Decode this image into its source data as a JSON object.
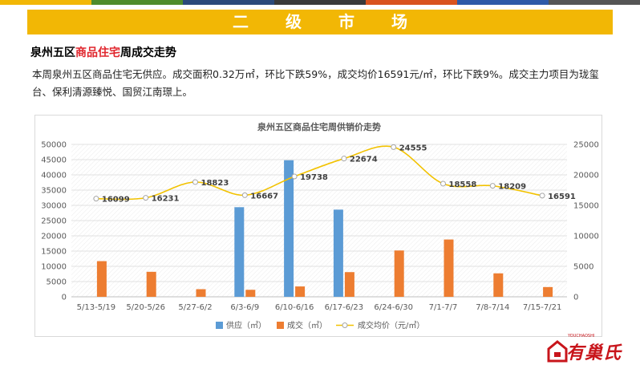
{
  "banner": {
    "title": "二级市场"
  },
  "section": {
    "title_prefix": "泉州五区",
    "title_highlight": "商品住宅",
    "title_suffix": "周成交走势"
  },
  "paragraph": "本周泉州五区商品住宅无供应。成交面积0.32万㎡，环比下跌59%，成交均价16591元/㎡，环比下跌9%。成交主力项目为珑玺台、保利清源臻悦、国贸江南璟上。",
  "colors": {
    "stripes": [
      "#f2b705",
      "#4f8c2b",
      "#2c4a7a",
      "#3a3a3a",
      "#d9531e",
      "#2e5aa8",
      "#555555"
    ],
    "banner": "#f2b705",
    "supply": "#5b9bd5",
    "deal": "#ed7d31",
    "price": "#f2c200"
  },
  "chart_data": {
    "type": "bar",
    "title": "泉州五区商品住宅周供销价走势",
    "categories": [
      "5/13-5/19",
      "5/20-5/26",
      "5/27-6/2",
      "6/3-6/9",
      "6/10-6/16",
      "6/17-6/23",
      "6/24-6/30",
      "7/1-7/7",
      "7/8-7/14",
      "7/15-7/21"
    ],
    "series": [
      {
        "name": "供应（㎡）",
        "type": "bar",
        "axis": "left",
        "values": [
          0,
          0,
          0,
          29400,
          44800,
          28600,
          0,
          0,
          0,
          0
        ]
      },
      {
        "name": "成交（㎡）",
        "type": "bar",
        "axis": "left",
        "values": [
          11700,
          8200,
          2500,
          2300,
          3400,
          8100,
          15200,
          18800,
          7700,
          3200
        ]
      },
      {
        "name": "成交均价（元/㎡）",
        "type": "line",
        "axis": "right",
        "values": [
          16099,
          16231,
          18823,
          16667,
          19738,
          22674,
          24555,
          18558,
          18209,
          16591
        ]
      }
    ],
    "ylim_left": [
      0,
      50000
    ],
    "ylim_right": [
      0,
      25000
    ],
    "yticks_left": [
      0,
      5000,
      10000,
      15000,
      20000,
      25000,
      30000,
      35000,
      40000,
      45000,
      50000
    ],
    "yticks_right": [
      0,
      5000,
      10000,
      15000,
      20000,
      25000
    ],
    "legend": "bottom",
    "grid": true
  },
  "brand": {
    "name": "有巢氏",
    "small": "YOUCHAOSHI"
  }
}
